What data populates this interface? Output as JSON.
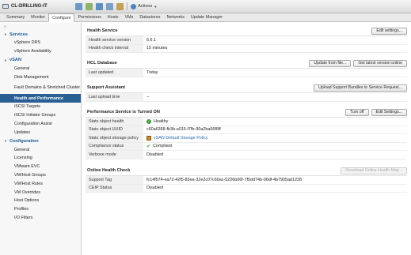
{
  "window": {
    "title": "CL-DRILLING-IT",
    "actions_label": "Actions"
  },
  "tabs": [
    {
      "label": "Summary"
    },
    {
      "label": "Monitor"
    },
    {
      "label": "Configure"
    },
    {
      "label": "Permissions"
    },
    {
      "label": "Hosts"
    },
    {
      "label": "VMs"
    },
    {
      "label": "Datastores"
    },
    {
      "label": "Networks"
    },
    {
      "label": "Update Manager"
    }
  ],
  "active_tab": "Configure",
  "sidebar": {
    "sections": [
      {
        "label": "Services",
        "items": [
          {
            "label": "vSphere DRS"
          },
          {
            "label": "vSphere Availability"
          }
        ]
      },
      {
        "label": "vSAN",
        "items": [
          {
            "label": "General"
          },
          {
            "label": "Disk Management"
          },
          {
            "label": "Fault Domains & Stretched Cluster"
          },
          {
            "label": "Health and Performance"
          },
          {
            "label": "iSCSI Targets"
          },
          {
            "label": "iSCSI Initiator Groups"
          },
          {
            "label": "Configuration Assist"
          },
          {
            "label": "Updates"
          }
        ]
      },
      {
        "label": "Configuration",
        "items": [
          {
            "label": "General"
          },
          {
            "label": "Licensing"
          },
          {
            "label": "VMware EVC"
          },
          {
            "label": "VM/Host Groups"
          },
          {
            "label": "VM/Host Rules"
          },
          {
            "label": "VM Overrides"
          },
          {
            "label": "Host Options"
          },
          {
            "label": "Profiles"
          },
          {
            "label": "I/O Filters"
          }
        ]
      }
    ],
    "selected": "Health and Performance"
  },
  "health_service": {
    "title": "Health Service",
    "edit_button": "Edit settings...",
    "rows": [
      {
        "key": "Health service version",
        "value": "6.6.1"
      },
      {
        "key": "Health check interval",
        "value": "15 minutes"
      }
    ]
  },
  "hcl_database": {
    "title": "HCL Database",
    "update_button": "Update from file...",
    "get_latest_button": "Get latest version online",
    "rows": [
      {
        "key": "Last updated",
        "value": "Today"
      }
    ]
  },
  "support_assistant": {
    "title": "Support Assistant",
    "upload_button": "Upload Support Bundles to Service Request...",
    "rows": [
      {
        "key": "Last upload time",
        "value": "--"
      }
    ]
  },
  "performance_service": {
    "title": "Performance Service is Turned ON",
    "turn_off_button": "Turn off",
    "edit_button": "Edit Settings...",
    "rows": [
      {
        "key": "Stats object health",
        "value": "Healthy"
      },
      {
        "key": "Stats object UUID",
        "value": "c60a6368-fb3b-a015-f7fb-90a2ba66f6ff"
      },
      {
        "key": "Stats object storage policy",
        "value": "vSAN Default Storage Policy"
      },
      {
        "key": "Compliance status",
        "value": "Compliant"
      },
      {
        "key": "Verbose mode",
        "value": "Disabled"
      }
    ]
  },
  "online_health_check": {
    "title": "Online Health Check",
    "download_button": "Download Online Health Map...",
    "rows": [
      {
        "key": "Support Tag",
        "value": "fc14f574-ea72-42f5-83ea-32e2c07c60ac-5226b06f-7f5dd74b-06df-4b7905ad1228"
      },
      {
        "key": "CEIP Status",
        "value": "Disabled"
      }
    ]
  },
  "colors": {
    "selected_bg": "#2a5f94",
    "section_text": "#1d5a94",
    "ok_green": "#3b9a3b"
  },
  "icons": [
    "host-cluster-icon",
    "add-host-icon",
    "new-vm-icon",
    "deploy-ovf-icon",
    "edit-settings-icon",
    "actions-gear-icon",
    "healthy-icon",
    "compliant-check-icon",
    "storage-policy-icon"
  ]
}
